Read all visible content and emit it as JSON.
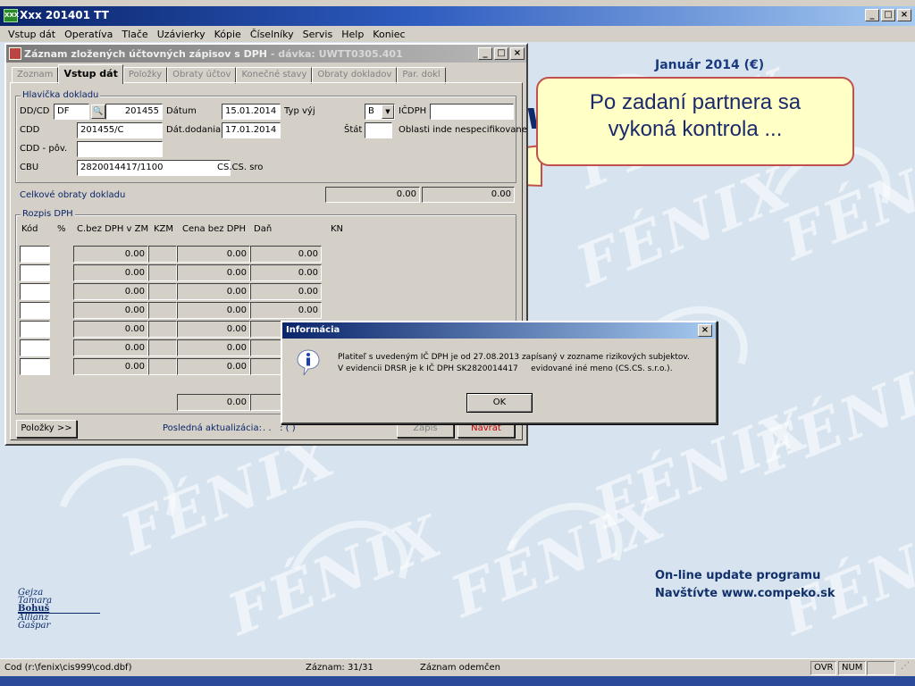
{
  "app": {
    "title": "Xxx 201401 TT",
    "icon_text": "XXX"
  },
  "menu": [
    "Vstup dát",
    "Operatíva",
    "Tlače",
    "Uzávierky",
    "Kópie",
    "Číselníky",
    "Servis",
    "Help",
    "Koniec"
  ],
  "desktop": {
    "month": "Január 2014 (€)",
    "logo_fragment": "vo",
    "update": "On-line update programu",
    "website": "Navštívte www.compeko.sk",
    "watermark": "FÉNIX",
    "users": [
      "Gejza",
      "Tamara",
      "Bohuš",
      "Allianz",
      "Gašpar"
    ]
  },
  "callout": {
    "line1": "Po zadaní partnera sa",
    "line2": "vykoná kontrola ..."
  },
  "window": {
    "title": "Záznam zložených účtovných zápisov s DPH",
    "title_suffix": " - dávka: UWTT0305.401",
    "tabs": [
      "Zoznam",
      "Vstup dát",
      "Položky",
      "Obraty účtov",
      "Konečné stavy",
      "Obraty dokladov",
      "Par. dokl"
    ],
    "active_tab": "Vstup dát"
  },
  "header_group": {
    "legend": "Hlavička dokladu",
    "ddcd_label": "DD/CD",
    "ddcd_value": "DF",
    "doc_number": "201455",
    "datum_label": "Dátum",
    "datum_value": "15.01.2014",
    "typ_label": "Typ výj",
    "typ_value": "B",
    "icdph_label": "IČDPH",
    "icdph_value": "",
    "cdd_label": "CDD",
    "cdd_value": "201455/C",
    "dat_dodania_label": "Dát.dodania",
    "dat_dodania_value": "17.01.2014",
    "stat_label": "Štát",
    "stat_value": "",
    "oblasti_label": "Oblasti inde nespecifikovane",
    "cdd_pov_label": "CDD - pôv.",
    "cdd_pov_value": "",
    "cbu_label": "CBU",
    "cbu_value": "2820014417/1100",
    "partner_name": "CS.CS. sro"
  },
  "totals": {
    "label": "Celkové obraty dokladu",
    "value1": "0.00",
    "value2": "0.00"
  },
  "vat_group": {
    "legend": "Rozpis DPH",
    "headers": [
      "Kód",
      "%",
      "C.bez DPH v ZM",
      "KZM",
      "Cena bez DPH",
      "Daň",
      "KN"
    ],
    "rows": [
      {
        "c_bez": "0.00",
        "cena": "0.00",
        "dan": "0.00"
      },
      {
        "c_bez": "0.00",
        "cena": "0.00",
        "dan": "0.00"
      },
      {
        "c_bez": "0.00",
        "cena": "0.00",
        "dan": "0.00"
      },
      {
        "c_bez": "0.00",
        "cena": "0.00",
        "dan": "0.00"
      },
      {
        "c_bez": "0.00",
        "cena": "0.00",
        "dan": "0.00"
      },
      {
        "c_bez": "0.00",
        "cena": "0.00",
        "dan": ""
      },
      {
        "c_bez": "0.00",
        "cena": "0.00",
        "dan": ""
      }
    ],
    "total_cena": "0.00"
  },
  "bottom": {
    "polozky_button": "Položky >>",
    "last_update_label": "Posledná aktualizácia:",
    "last_update_value": ". .   : ( )",
    "zapis_button": "Zápis",
    "navrat_button": "Návrat"
  },
  "dialog": {
    "title": "Informácia",
    "message_line1": "Platiteľ s uvedeným IČ DPH je od 27.08.2013 zapísaný v zozname rizikových subjektov.",
    "message_line2": "V evidencii DRSR je k IČ DPH SK2820014417     evidované iné meno (CS.CS. s.r.o.).",
    "ok_label": "OK"
  },
  "status": {
    "path": "Cod (r:\\fenix\\cis999\\cod.dbf)",
    "record": "Záznam: 31/31",
    "record_state": "Záznam odemčen",
    "ovr": "OVR",
    "num": "NUM"
  },
  "colors": {
    "titlebar": "#0a246a",
    "callout_fill": "#ffffc6",
    "callout_border": "#c0504d",
    "desktop": "#d7e4ef"
  }
}
